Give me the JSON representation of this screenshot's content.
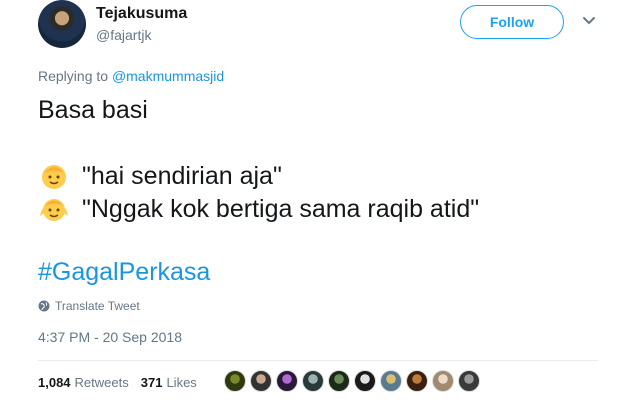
{
  "tweet": {
    "author_name": "Tejakusuma",
    "author_handle": "@fajartjk",
    "follow_label": "Follow",
    "replying_prefix": "Replying to ",
    "replying_to": "@makmummasjid",
    "lines": [
      "Basa basi",
      "\"hai sendirian aja\"",
      "\"Nggak kok bertiga sama raqib atid\""
    ],
    "hashtag": "#GagalPerkasa",
    "translate_label": "Translate Tweet",
    "timestamp": "4:37 PM - 20 Sep 2018",
    "retweets_count": "1,084",
    "retweets_label": "Retweets",
    "likes_count": "371",
    "likes_label": "Likes"
  },
  "colors": {
    "accent": "#1da1f2",
    "link": "#1b95e0",
    "secondary_text": "#657786",
    "primary_text": "#14171a",
    "divider": "#e6ecf0"
  },
  "icons": [
    "chevron-down-icon",
    "globe-icon",
    "baby-emoji-icon",
    "baby-angel-emoji-icon"
  ]
}
